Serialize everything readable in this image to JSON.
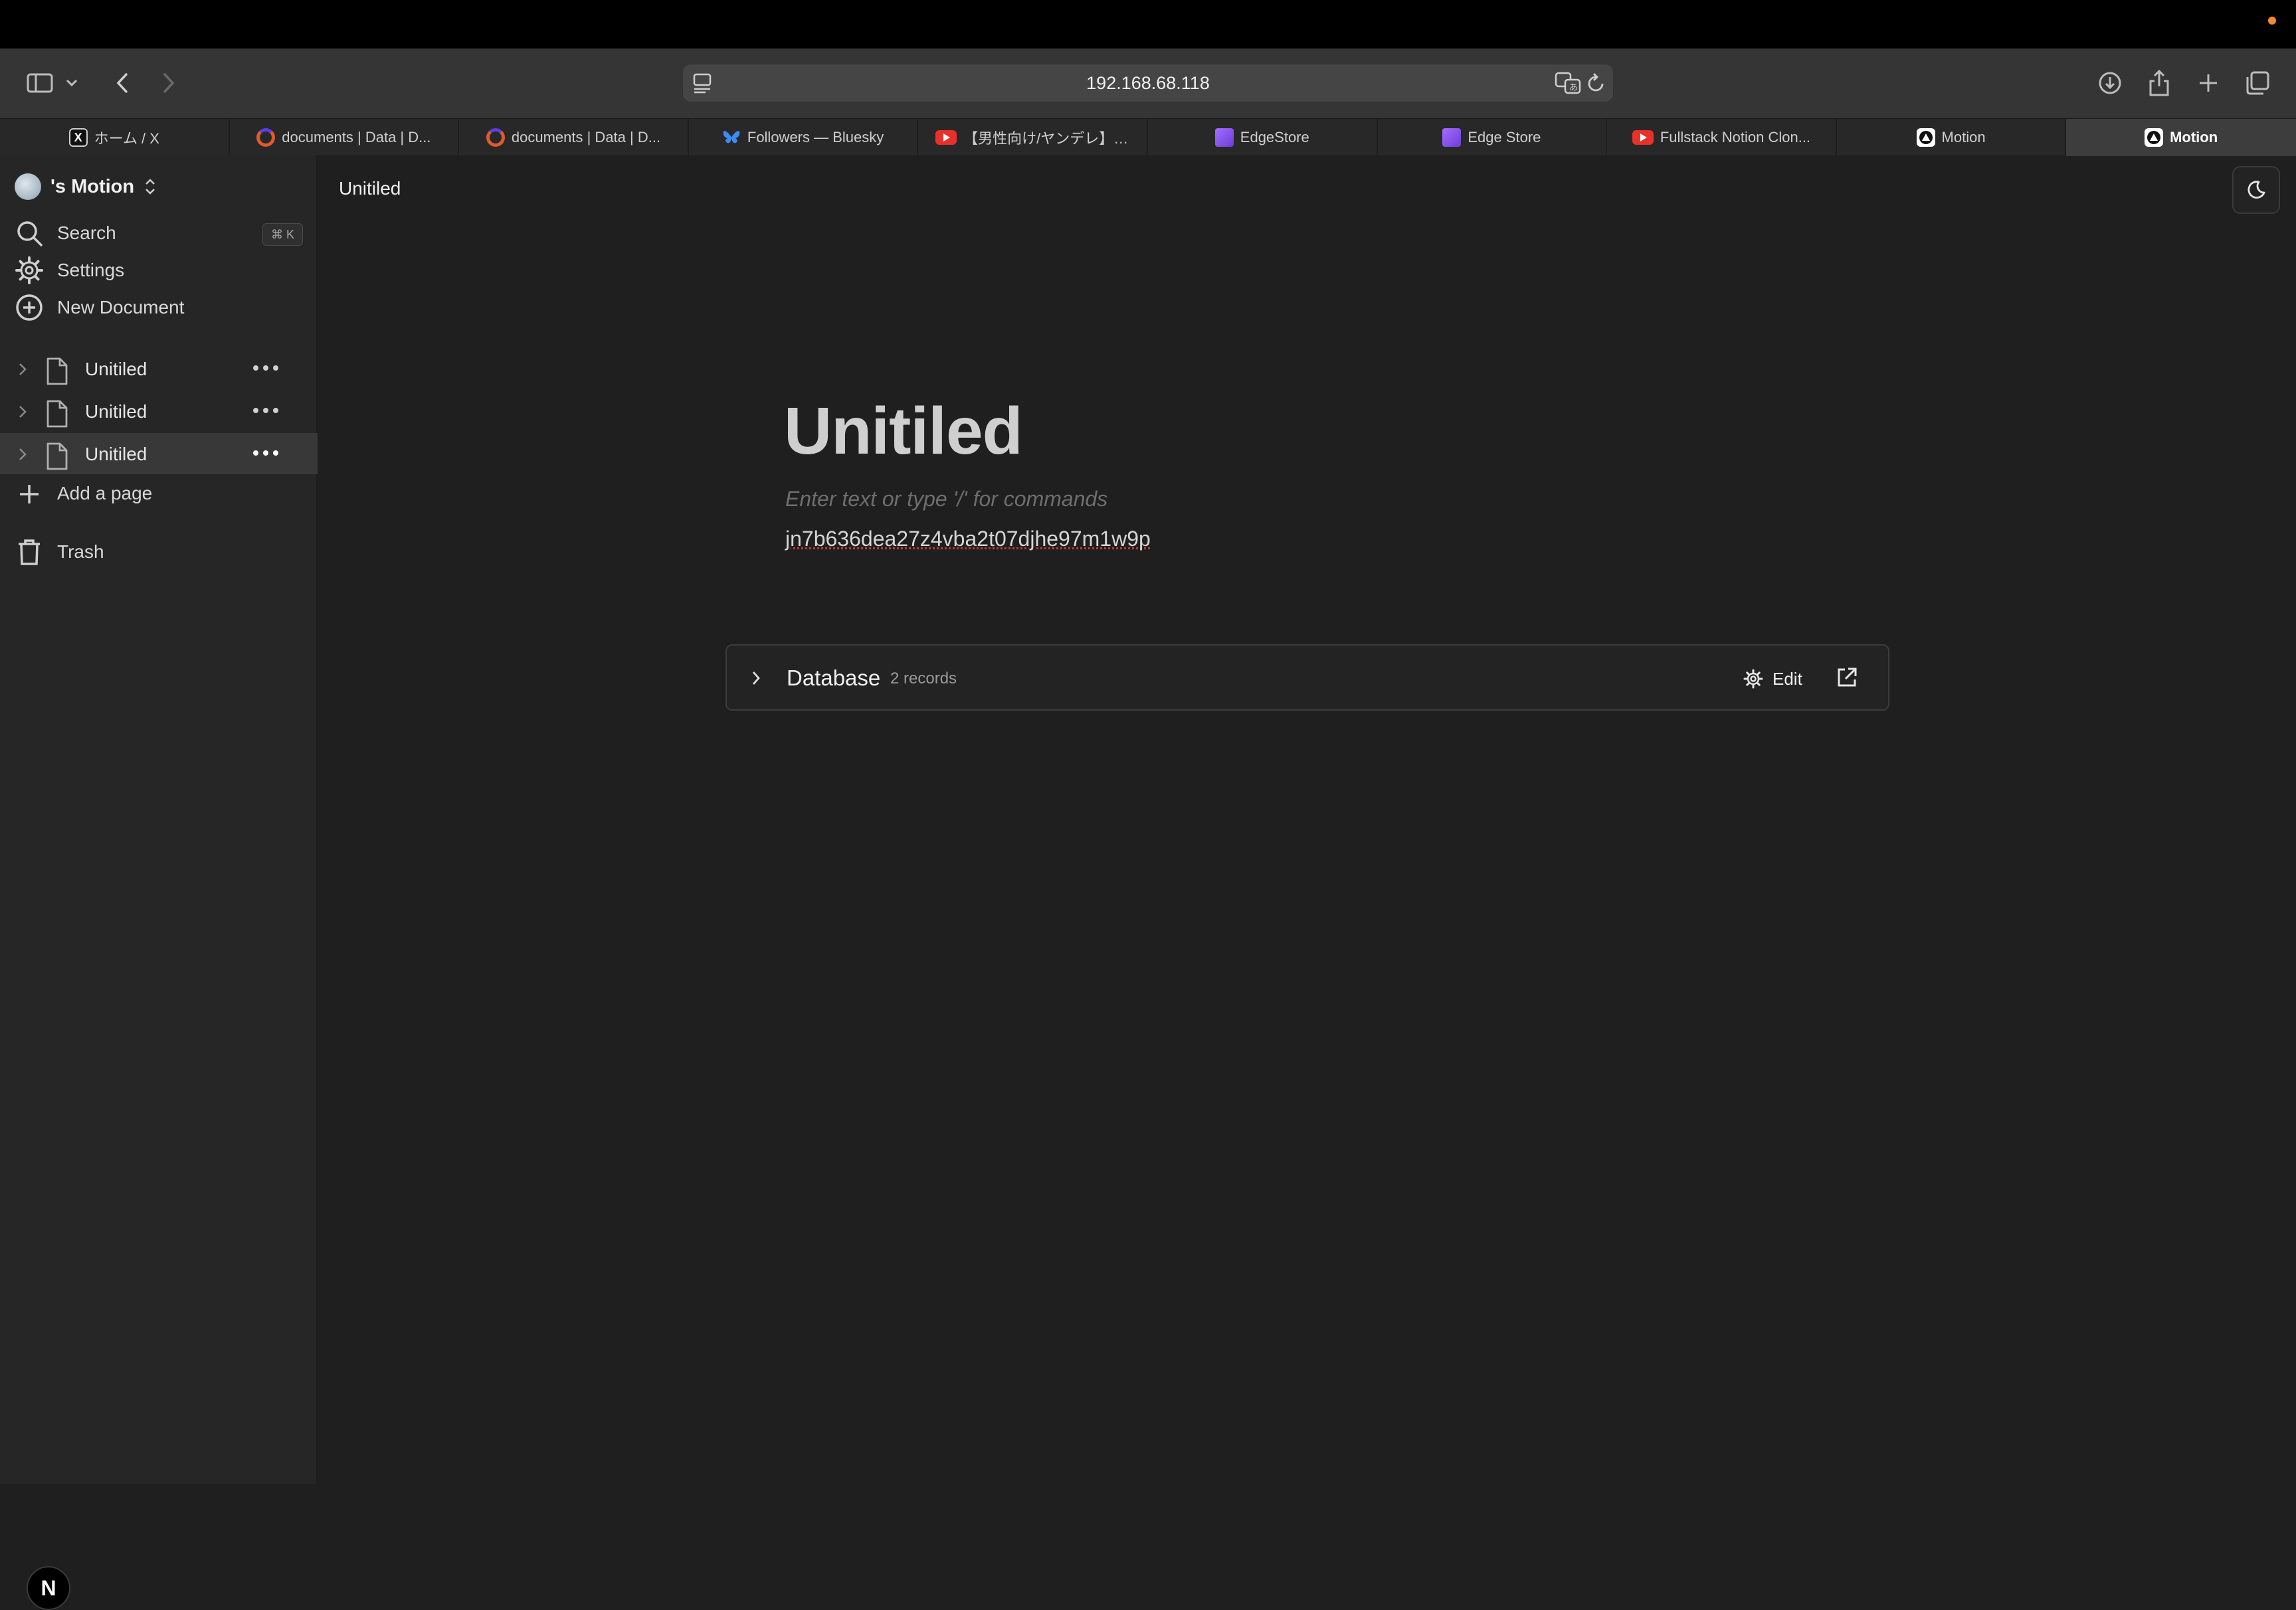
{
  "browser": {
    "url": "192.168.68.118",
    "tabs": [
      {
        "title": "ホーム / X",
        "favicon": "x-icon",
        "active": false
      },
      {
        "title": "documents | Data | D...",
        "favicon": "convex-icon",
        "active": false
      },
      {
        "title": "documents | Data | D...",
        "favicon": "convex-icon",
        "active": false
      },
      {
        "title": "Followers — Bluesky",
        "favicon": "bluesky-icon",
        "active": false
      },
      {
        "title": "【男性向け/ヤンデレ】嫡...",
        "favicon": "youtube-icon",
        "active": false
      },
      {
        "title": "EdgeStore",
        "favicon": "cube-icon",
        "active": false
      },
      {
        "title": "Edge Store",
        "favicon": "cube-icon",
        "active": false
      },
      {
        "title": "Fullstack Notion Clon...",
        "favicon": "youtube-icon",
        "active": false
      },
      {
        "title": "Motion",
        "favicon": "motion-icon",
        "active": false
      },
      {
        "title": "Motion",
        "favicon": "motion-icon",
        "active": true
      }
    ]
  },
  "sidebar": {
    "workspace": "'s Motion",
    "search_label": "Search",
    "search_shortcut": "⌘ K",
    "settings_label": "Settings",
    "new_document_label": "New Document",
    "pages": [
      {
        "title": "Unitiled",
        "selected": false
      },
      {
        "title": "Unitiled",
        "selected": false
      },
      {
        "title": "Unitiled",
        "selected": true
      }
    ],
    "add_page_label": "Add a page",
    "trash_label": "Trash",
    "logo_letter": "N"
  },
  "main": {
    "breadcrumb": "Unitiled",
    "title": "Unitiled",
    "placeholder": "Enter text or type '/' for commands",
    "document_id": "jn7b636dea27z4vba2t07djhe97m1w9p",
    "database": {
      "title": "Database",
      "records": "2 records",
      "edit_label": "Edit"
    }
  },
  "colors": {
    "background": "#1f1f1f",
    "sidebar": "#262626",
    "toolbar": "#353535",
    "accent_dot": "#f5892e"
  }
}
